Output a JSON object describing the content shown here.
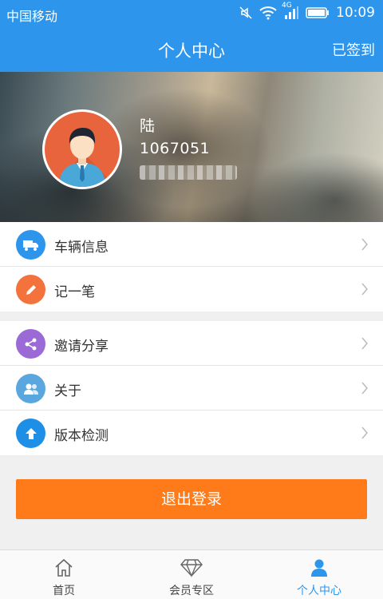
{
  "status_bar": {
    "carrier": "中国移动",
    "network": "4G",
    "time": "10:09",
    "icons": [
      "mute-icon",
      "wifi-icon",
      "signal-icon",
      "battery-icon"
    ]
  },
  "header": {
    "title": "个人中心",
    "sign_in_status": "已签到"
  },
  "profile": {
    "name": "陆",
    "user_id": "1067051",
    "phone_masked": "1**********"
  },
  "menu_group_1": [
    {
      "label": "车辆信息",
      "icon": "truck-icon",
      "color": "#2d96ec"
    },
    {
      "label": "记一笔",
      "icon": "pencil-icon",
      "color": "#f4733c"
    }
  ],
  "menu_group_2": [
    {
      "label": "邀请分享",
      "icon": "share-icon",
      "color": "#9b6ad6"
    },
    {
      "label": "关于",
      "icon": "users-icon",
      "color": "#5aa7e0"
    },
    {
      "label": "版本检测",
      "icon": "upload-arrow-icon",
      "color": "#1e8fe6"
    }
  ],
  "logout_label": "退出登录",
  "tabbar": [
    {
      "label": "首页",
      "icon": "home-icon",
      "active": false
    },
    {
      "label": "会员专区",
      "icon": "diamond-icon",
      "active": false
    },
    {
      "label": "个人中心",
      "icon": "person-icon",
      "active": true
    }
  ],
  "colors": {
    "primary": "#2d96ec",
    "logout": "#ff7b1a",
    "background": "#f0f0f0"
  }
}
